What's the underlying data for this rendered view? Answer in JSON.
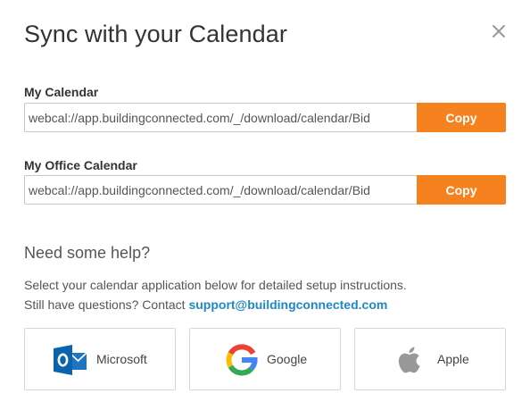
{
  "dialog": {
    "title": "Sync with your Calendar",
    "close_icon": "close-icon"
  },
  "my_calendar": {
    "label": "My Calendar",
    "url": "webcal://app.buildingconnected.com/_/download/calendar/Bid",
    "copy_label": "Copy"
  },
  "office_calendar": {
    "label": "My Office Calendar",
    "url": "webcal://app.buildingconnected.com/_/download/calendar/Bid",
    "copy_label": "Copy"
  },
  "help": {
    "heading": "Need some help?",
    "line1": "Select your calendar application below for detailed setup instructions.",
    "line2_prefix": "Still have questions? Contact ",
    "support_email": "support@buildingconnected.com"
  },
  "apps": [
    {
      "label": "Microsoft",
      "icon": "outlook-icon"
    },
    {
      "label": "Google",
      "icon": "google-icon"
    },
    {
      "label": "Apple",
      "icon": "apple-icon"
    }
  ],
  "colors": {
    "accent": "#f5821f",
    "link": "#1e88c7",
    "outlook_blue": "#0a64ad"
  }
}
